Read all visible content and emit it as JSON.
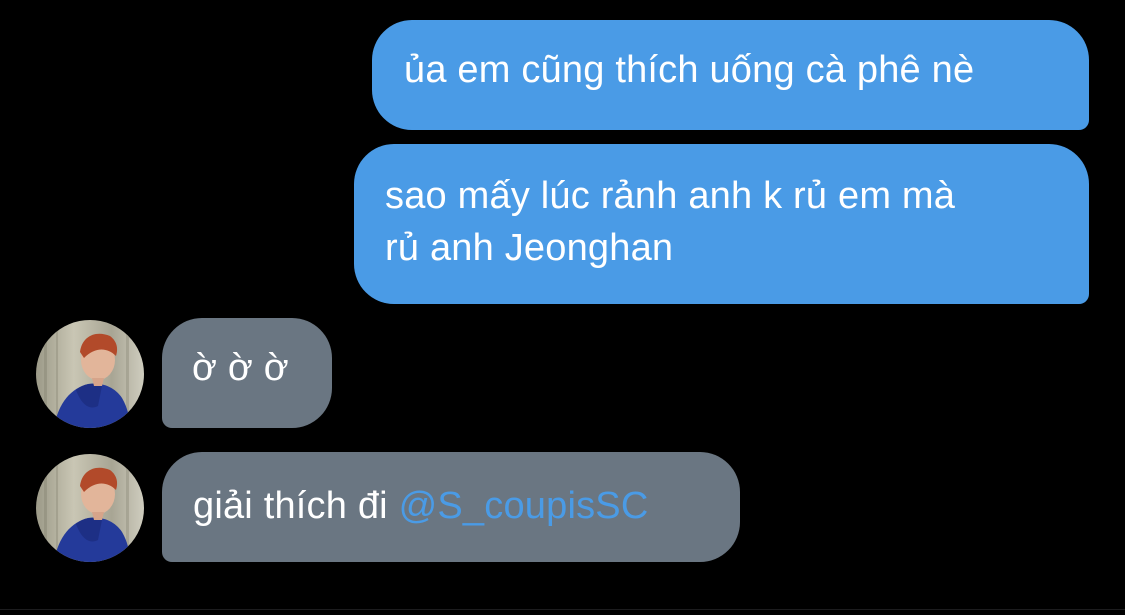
{
  "conversation": {
    "messages": [
      {
        "direction": "outgoing",
        "text": "ủa em cũng thích uống cà phê nè"
      },
      {
        "direction": "outgoing",
        "text_line1": "sao mấy lúc rảnh anh k rủ em mà",
        "text_line2": "rủ anh Jeonghan"
      },
      {
        "direction": "incoming",
        "text": "ờ ờ ờ"
      },
      {
        "direction": "incoming",
        "text": "giải thích đi",
        "mention": "@S_coupisSC"
      }
    ]
  },
  "colors": {
    "background": "#000000",
    "outgoing_bubble": "#4a9be6",
    "incoming_bubble": "#6a7682",
    "mention": "#4a9be6",
    "text": "#ffffff"
  },
  "icons": {
    "avatar": "profile-photo-avatar"
  }
}
